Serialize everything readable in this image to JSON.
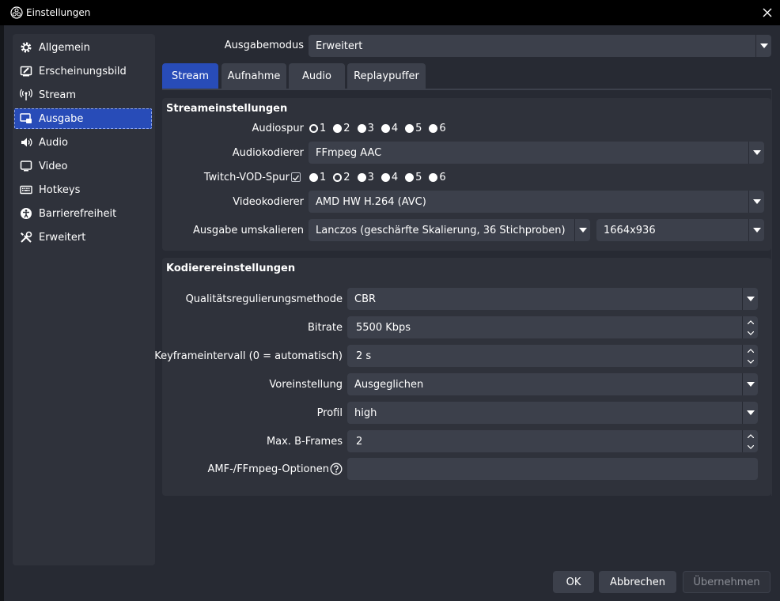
{
  "window": {
    "title": "Einstellungen"
  },
  "sidebar": {
    "items": [
      {
        "label": "Allgemein",
        "icon": "gear-icon"
      },
      {
        "label": "Erscheinungsbild",
        "icon": "appearance-icon"
      },
      {
        "label": "Stream",
        "icon": "antenna-icon"
      },
      {
        "label": "Ausgabe",
        "icon": "output-icon",
        "active": true
      },
      {
        "label": "Audio",
        "icon": "speaker-icon"
      },
      {
        "label": "Video",
        "icon": "monitor-icon"
      },
      {
        "label": "Hotkeys",
        "icon": "keyboard-icon"
      },
      {
        "label": "Barrierefreiheit",
        "icon": "accessibility-icon"
      },
      {
        "label": "Erweitert",
        "icon": "tools-icon"
      }
    ]
  },
  "output_mode": {
    "label": "Ausgabemodus",
    "value": "Erweitert"
  },
  "tabs": [
    {
      "label": "Stream",
      "active": true
    },
    {
      "label": "Aufnahme"
    },
    {
      "label": "Audio"
    },
    {
      "label": "Replaypuffer"
    }
  ],
  "stream_settings": {
    "title": "Streameinstellungen",
    "audio_track": {
      "label": "Audiospur",
      "options": [
        "1",
        "2",
        "3",
        "4",
        "5",
        "6"
      ],
      "selected": "1"
    },
    "audio_encoder": {
      "label": "Audiokodierer",
      "value": "FFmpeg AAC"
    },
    "twitch_vod": {
      "label": "Twitch-VOD-Spur",
      "checked": true,
      "options": [
        "1",
        "2",
        "3",
        "4",
        "5",
        "6"
      ],
      "selected": "2"
    },
    "video_encoder": {
      "label": "Videokodierer",
      "value": "AMD HW H.264 (AVC)"
    },
    "rescale": {
      "label": "Ausgabe umskalieren",
      "filter": "Lanczos (geschärfte Skalierung, 36 Stichproben)",
      "resolution": "1664x936"
    }
  },
  "encoder_settings": {
    "title": "Kodierereinstellungen",
    "rate_control": {
      "label": "Qualitätsregulierungsmethode",
      "value": "CBR"
    },
    "bitrate": {
      "label": "Bitrate",
      "value": "5500 Kbps"
    },
    "keyframe": {
      "label": "Keyframeintervall (0 = automatisch)",
      "value": "2 s"
    },
    "preset": {
      "label": "Voreinstellung",
      "value": "Ausgeglichen"
    },
    "profile": {
      "label": "Profil",
      "value": "high"
    },
    "bframes": {
      "label": "Max. B-Frames",
      "value": "2"
    },
    "amf_options": {
      "label": "AMF-/FFmpeg-Optionen",
      "value": ""
    }
  },
  "buttons": {
    "ok": "OK",
    "cancel": "Abbrechen",
    "apply": "Übernehmen"
  },
  "colors": {
    "accent": "#284cb8",
    "background": "#272a33",
    "panel": "#2f323b",
    "input": "#3c404b"
  }
}
